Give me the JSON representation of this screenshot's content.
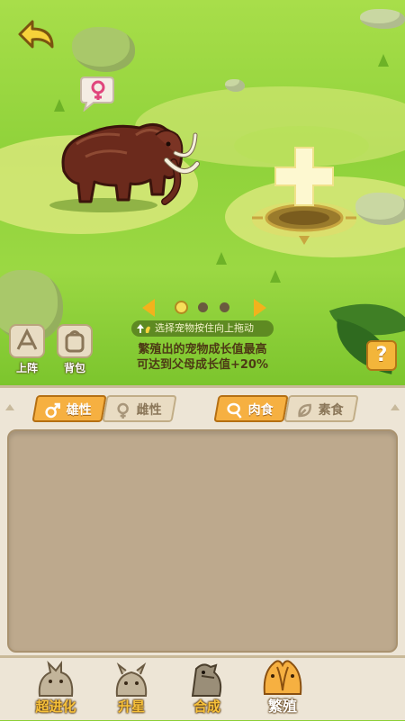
{
  "scene": {
    "back_icon": "back-arrow-icon",
    "pet_gender_icon": "female-symbol-icon",
    "slot_icon": "plus-icon",
    "pager": {
      "pages": 3,
      "current": 1
    },
    "hint": "选择宠物按住向上拖动",
    "info_line1": "繁殖出的宠物成长值最高",
    "info_line2": "可达到父母成长值+20%",
    "side_buttons": [
      {
        "label": "上阵",
        "icon": "deploy-icon"
      },
      {
        "label": "背包",
        "icon": "backpack-icon"
      }
    ],
    "help_label": "?"
  },
  "panel": {
    "gender_tabs": [
      {
        "label": "雄性",
        "icon": "male-symbol-icon",
        "active": true
      },
      {
        "label": "雌性",
        "icon": "female-symbol-icon",
        "active": false
      }
    ],
    "diet_tabs": [
      {
        "label": "肉食",
        "icon": "meat-icon",
        "active": true
      },
      {
        "label": "素食",
        "icon": "leaf-icon",
        "active": false
      }
    ]
  },
  "nav": [
    {
      "label": "超进化",
      "icon": "super-evolution-icon"
    },
    {
      "label": "升星",
      "icon": "star-up-icon"
    },
    {
      "label": "合成",
      "icon": "synthesis-icon"
    },
    {
      "label": "繁殖",
      "icon": "breeding-icon",
      "active": true
    }
  ],
  "colors": {
    "accent": "#f6b041",
    "grass": "#8fd23a",
    "panel": "#ede5d6",
    "list_bg": "#bda98d"
  }
}
